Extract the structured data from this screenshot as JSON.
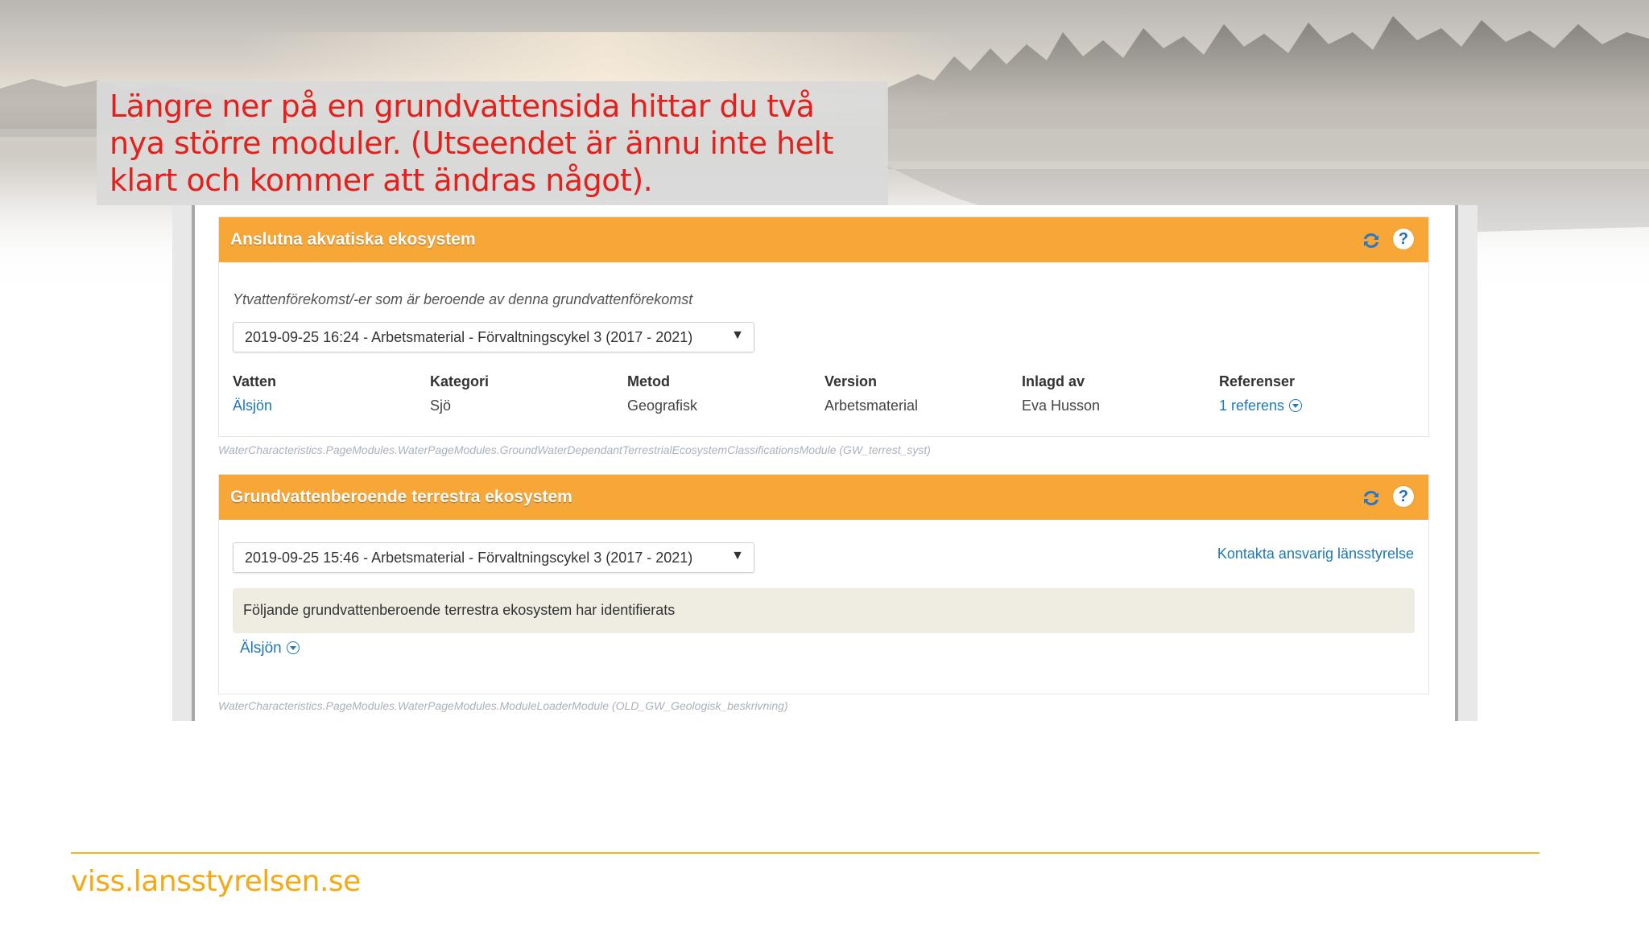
{
  "callout": {
    "lines": [
      "Längre ner på en grundvattensida hittar du två",
      "nya större moduler. (Utseendet är ännu inte helt",
      "klart och kommer att ändras något)."
    ]
  },
  "module1": {
    "title": "Anslutna akvatiska ekosystem",
    "subtitle": "Ytvattenförekomst/-er som är beroende av denna grundvattenförekomst",
    "select_value": "2019-09-25 16:24 - Arbetsmaterial - Förvaltningscykel 3 (2017 - 2021)",
    "columns": [
      {
        "header": "Vatten",
        "value": "Älsjön"
      },
      {
        "header": "Kategori",
        "value": "Sjö"
      },
      {
        "header": "Metod",
        "value": "Geografisk"
      },
      {
        "header": "Version",
        "value": "Arbetsmaterial"
      },
      {
        "header": "Inlagd av",
        "value": "Eva Husson"
      },
      {
        "header": "Referenser",
        "value": "1 referens"
      }
    ],
    "module_path": "WaterCharacteristics.PageModules.WaterPageModules.GroundWaterDependantTerrestrialEcosystemClassificationsModule (GW_terrest_syst)"
  },
  "module2": {
    "title": "Grundvattenberoende terrestra ekosystem",
    "select_value": "2019-09-25 15:46 - Arbetsmaterial - Förvaltningscykel 3 (2017 - 2021)",
    "contact_link": "Kontakta ansvarig länsstyrelse",
    "info_text": "Följande grundvattenberoende terrestra ekosystem har identifierats",
    "item": "Älsjön",
    "module_path": "WaterCharacteristics.PageModules.WaterPageModules.ModuleLoaderModule (OLD_GW_Geologisk_beskrivning)"
  },
  "icons": {
    "refresh": "refresh-icon",
    "help": "?"
  },
  "footer": {
    "site": "viss.lansstyrelsen.se"
  },
  "colors": {
    "header_orange": "#f6a738",
    "link_blue": "#1f78b4",
    "callout_red": "#e3201b",
    "footer_gold": "#f4a915"
  }
}
